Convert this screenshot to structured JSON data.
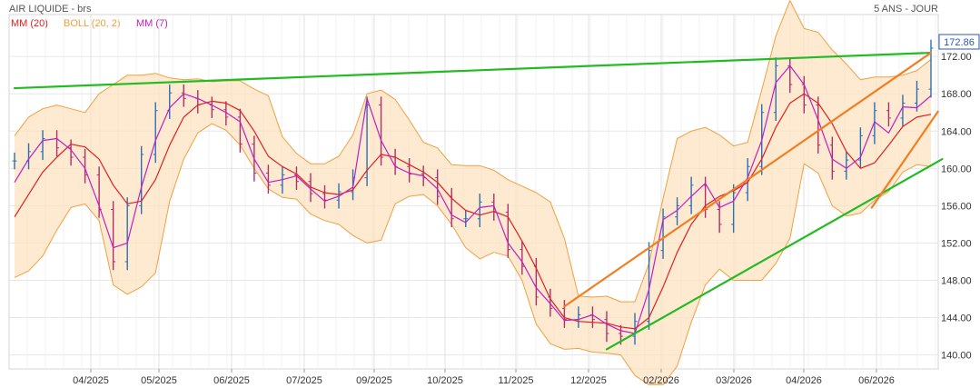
{
  "header": {
    "title": "AIR LIQUIDE - brs",
    "period": "5 ANS - JOUR"
  },
  "legend": [
    {
      "label": "MM (20)",
      "color": "#e02020"
    },
    {
      "label": "BOLL (20, 2)",
      "color": "#f0a040"
    },
    {
      "label": "MM (7)",
      "color": "#c020c0"
    }
  ],
  "last_price": {
    "label": "172.86",
    "color": "#2a55c0"
  },
  "chart_data": {
    "type": "ohlc",
    "title": "AIR LIQUIDE - brs",
    "period": "5 ANS - JOUR",
    "x_tick_labels": [
      "04/2025",
      "05/2025",
      "06/2025",
      "07/2025",
      "09/2025",
      "10/2025",
      "11/2025",
      "12/2025",
      "02/2026",
      "03/2026",
      "04/2026",
      "06/2026"
    ],
    "y_tick_labels": [
      "140.00",
      "144.00",
      "148.00",
      "152.00",
      "156.00",
      "160.00",
      "164.00",
      "168.00",
      "172.00"
    ],
    "ylim": [
      138.5,
      176.5
    ],
    "grid": true,
    "last_price": 172.86,
    "series": [
      {
        "name": "MM (20)",
        "color": "#e02020",
        "values": [
          154.8,
          157.2,
          159.6,
          161.2,
          162.6,
          162.3,
          161.0,
          158.2,
          156.2,
          156.5,
          158.8,
          162.5,
          165.5,
          166.8,
          167.2,
          167.0,
          166.2,
          164.0,
          161.3,
          160.2,
          159.4,
          158.0,
          157.4,
          157.2,
          157.7,
          159.8,
          161.5,
          161.2,
          160.4,
          159.6,
          158.5,
          156.8,
          155.5,
          155.0,
          155.4,
          154.8,
          152.2,
          149.3,
          146.0,
          144.0,
          143.6,
          143.5,
          143.4,
          143.0,
          142.8,
          144.0,
          147.3,
          151.0,
          154.0,
          156.0,
          157.0,
          157.6,
          158.5,
          161.0,
          164.4,
          167.0,
          168.0,
          167.0,
          164.8,
          161.8,
          160.0,
          160.6,
          162.5,
          164.5,
          165.5,
          165.8
        ]
      },
      {
        "name": "MM (7)",
        "color": "#c020c0",
        "values": [
          158.5,
          161.0,
          163.0,
          163.2,
          162.0,
          160.0,
          156.0,
          151.5,
          152.0,
          158.0,
          163.0,
          166.5,
          168.0,
          167.5,
          166.8,
          166.0,
          165.0,
          161.0,
          158.5,
          158.8,
          159.2,
          157.8,
          156.5,
          157.0,
          158.0,
          167.5,
          163.0,
          160.2,
          159.5,
          159.2,
          157.8,
          155.0,
          154.2,
          155.8,
          156.0,
          152.0,
          150.0,
          147.2,
          145.5,
          143.7,
          143.8,
          144.3,
          143.3,
          142.6,
          142.3,
          147.0,
          154.5,
          155.5,
          157.0,
          158.4,
          155.8,
          156.5,
          159.0,
          163.0,
          169.2,
          171.0,
          169.0,
          165.2,
          161.0,
          160.0,
          161.2,
          165.0,
          163.8,
          166.6,
          166.5,
          167.8
        ]
      },
      {
        "name": "BOLL (20, 2) upper",
        "color": "#f0a040",
        "values": [
          163.5,
          165.5,
          166.4,
          166.8,
          166.4,
          166.0,
          168.0,
          169.0,
          170.0,
          170.0,
          170.2,
          169.7,
          169.5,
          169.6,
          169.3,
          169.4,
          169.4,
          168.5,
          167.8,
          163.4,
          161.6,
          160.5,
          160.5,
          161.3,
          163.6,
          168.0,
          168.4,
          167.4,
          165.2,
          162.8,
          162.2,
          160.4,
          160.3,
          160.3,
          159.8,
          158.8,
          158.1,
          157.4,
          156.4,
          152.5,
          146.3,
          146.2,
          146.3,
          145.7,
          145.7,
          149.8,
          156.8,
          163.2,
          164.0,
          164.4,
          163.6,
          162.4,
          162.8,
          168.4,
          174.2,
          178.0,
          175.0,
          174.6,
          172.7,
          171.2,
          169.5,
          169.8,
          169.8,
          170.0,
          170.5,
          171.7
        ]
      },
      {
        "name": "BOLL (20, 2) lower",
        "color": "#f0a040",
        "values": [
          148.3,
          149.0,
          150.6,
          153.4,
          155.8,
          156.2,
          154.4,
          147.5,
          146.5,
          147.3,
          148.8,
          156.5,
          161.0,
          163.8,
          164.8,
          164.1,
          162.5,
          160.0,
          157.8,
          156.9,
          156.7,
          155.1,
          154.4,
          154.0,
          152.8,
          152.0,
          152.3,
          156.2,
          157.0,
          157.2,
          156.0,
          154.0,
          151.5,
          150.3,
          151.0,
          150.6,
          148.0,
          143.3,
          141.2,
          140.6,
          140.7,
          140.3,
          140.2,
          140.0,
          137.8,
          136.8,
          136.8,
          138.8,
          143.5,
          147.5,
          149.2,
          148.0,
          148.0,
          148.0,
          149.8,
          152.5,
          160.5,
          159.5,
          156.0,
          154.9,
          155.2,
          156.6,
          157.5,
          159.6,
          160.4,
          160.2
        ]
      },
      {
        "name": "Prix",
        "color": "#2e6fb0",
        "values": [
          160.8,
          161.8,
          163.2,
          162.2,
          161.2,
          159.3,
          155.6,
          150.0,
          156.0,
          161.5,
          166.2,
          168.1,
          167.5,
          166.8,
          166.3,
          165.5,
          162.6,
          159.5,
          158.2,
          159.3,
          158.6,
          157.3,
          156.6,
          157.5,
          159.0,
          166.8,
          161.2,
          160.2,
          159.4,
          159.0,
          157.0,
          154.6,
          154.6,
          156.4,
          155.3,
          151.3,
          149.5,
          146.2,
          145.0,
          143.8,
          144.3,
          143.8,
          142.3,
          142.0,
          143.6,
          151.2,
          154.8,
          156.0,
          158.2,
          155.6,
          154.0,
          157.4,
          160.2,
          166.0,
          171.0,
          169.0,
          166.8,
          162.5,
          159.7,
          160.9,
          163.5,
          166.2,
          165.4,
          167.0,
          168.5,
          172.9
        ]
      }
    ]
  },
  "trendlines": [
    {
      "name": "resistance horizontale",
      "color": "#22bb22",
      "from": [
        0,
        168.6
      ],
      "to": [
        65,
        172.4
      ]
    },
    {
      "name": "support ascendant",
      "color": "#22bb22",
      "from": [
        42,
        140.6
      ],
      "to": [
        65.8,
        161.0
      ]
    },
    {
      "name": "canal haut",
      "color": "#f07f22",
      "from": [
        39,
        145.2
      ],
      "to": [
        65,
        172.4
      ]
    },
    {
      "name": "canal bas",
      "color": "#f07f22",
      "from": [
        60.8,
        155.8
      ],
      "to": [
        65.5,
        166.1
      ]
    }
  ]
}
